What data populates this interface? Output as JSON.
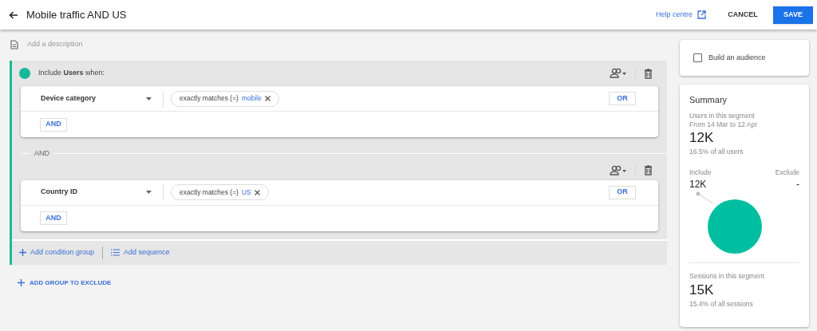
{
  "header": {
    "title": "Mobile traffic AND US",
    "help_link": "Help centre",
    "buttons": [
      "CANCEL",
      "SAVE"
    ]
  },
  "description": {
    "placeholder": "Add a description"
  },
  "include_group": {
    "heading": "Include **Users** when:",
    "conditions": [
      {
        "field": "Device category",
        "operator": "exactly matches (=)",
        "value": "mobile",
        "or_button": "OR",
        "and_button": "AND"
      },
      {
        "field": "Country ID",
        "operator": "exactly matches (=)",
        "value": "US",
        "or_button": "OR",
        "and_button": "AND"
      }
    ],
    "joiner": "AND",
    "actions": [
      "Add condition group",
      "Add sequence"
    ]
  },
  "exclude_link": "ADD GROUP TO EXCLUDE",
  "audience": {
    "label": "Build an audience",
    "checked": false
  },
  "summary": {
    "title": "Summary",
    "users_label": "Users in this segment",
    "date_range": "From 14 Mar to 12 Apr",
    "users_value": "12K",
    "users_share": "16.5% of all users",
    "include_label": "Include",
    "exclude_label": "Exclude",
    "include_value": "12K",
    "exclude_value": "-",
    "sessions_label": "Sessions in this segment",
    "sessions_value": "15K",
    "sessions_share": "15.4% of all sessions"
  }
}
